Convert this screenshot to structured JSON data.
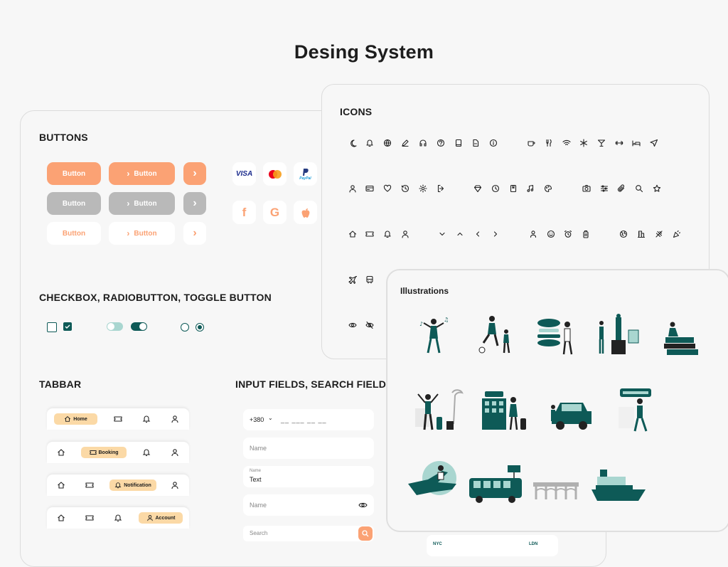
{
  "page": {
    "title": "Desing System"
  },
  "buttons": {
    "section_title": "BUTTONS",
    "label": "Button",
    "orange": "#fba274",
    "gray": "#b9b9b9",
    "payment_icons": [
      "visa-icon",
      "mastercard-icon",
      "paypal-icon",
      "facebook-icon",
      "google-icon",
      "apple-icon"
    ],
    "visa": "VISA",
    "paypal": "PayPal"
  },
  "controls": {
    "section_title": "CHECKBOX, RADIOBUTTON, TOGGLE BUTTON",
    "teal": "#0e5a57"
  },
  "tabbar": {
    "section_title": "TABBAR",
    "home": "Home",
    "booking": "Booking",
    "notification": "Notification",
    "account": "Account"
  },
  "inputs": {
    "section_title": "INPUT FIELDS, SEARCH FIELD",
    "phone_code": "+380",
    "phone_mask": "__ ___ __ __",
    "name_placeholder": "Name",
    "filled_label": "Name",
    "filled_value": "Text",
    "password_placeholder": "Name",
    "search_placeholder": "Search"
  },
  "icons": {
    "section_title": "ICONS",
    "rows": [
      [
        "moon-icon",
        "bell-icon",
        "globe-icon",
        "pen-icon",
        "headset-icon",
        "help-icon",
        "book-icon",
        "file-icon",
        "info-icon",
        "coffee-icon",
        "fork-knife-icon",
        "wifi-icon",
        "snowflake-icon",
        "cocktail-icon",
        "dumbbell-icon",
        "bed-icon",
        "plane-up-icon"
      ],
      [
        "user-icon",
        "card-icon",
        "heart-icon",
        "history-icon",
        "settings-icon",
        "logout-icon",
        "diamond-icon",
        "clock-icon",
        "bookmark-icon",
        "music-icon",
        "palette-icon",
        "camera-icon",
        "sliders-icon",
        "paperclip-icon",
        "search-icon",
        "star-icon"
      ],
      [
        "home-icon",
        "ticket-icon",
        "bell-icon",
        "user-icon",
        "chevron-down-icon",
        "chevron-up-icon",
        "chevron-left-icon",
        "chevron-right-icon",
        "person-icon",
        "smile-icon",
        "alarm-icon",
        "luggage-icon",
        "earth-icon",
        "buildings-icon",
        "airplane-icon",
        "party-icon"
      ],
      [
        "plane-icon",
        "bus-icon"
      ],
      [
        "eye-icon",
        "eye-off-icon"
      ]
    ]
  },
  "illustrations": {
    "section_title": "Illustrations",
    "teal": "#0e5a57",
    "light_teal": "#a9d6d0"
  },
  "footer_card": {
    "from": "NYC",
    "to": "LDN"
  }
}
